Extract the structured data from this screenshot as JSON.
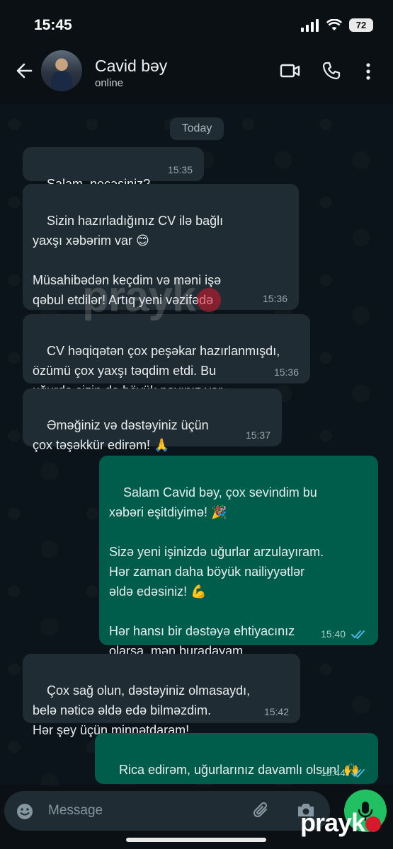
{
  "status_bar": {
    "time": "15:45",
    "battery": "72"
  },
  "header": {
    "contact_name": "Cavid bəy",
    "contact_status": "online"
  },
  "chat": {
    "date_chip": "Today",
    "messages": [
      {
        "text": "Salam, necəsiniz?",
        "time": "15:35"
      },
      {
        "text": "Sizin hazırladığınız CV ilə bağlı\nyaxşı xəbərim var 😊\n\nMüsahibədən keçdim və məni işə\nqəbul etdilər! Artıq yeni vəzifədə\nçalışıram.",
        "time": "15:36"
      },
      {
        "text": "CV həqiqətən çox peşəkar hazırlanmışdı,\nözümü çox yaxşı təqdim etdi. Bu\nuğurda sizin də böyük payınız var.",
        "time": "15:36"
      },
      {
        "text": "Əməğiniz və dəstəyiniz üçün\nçox təşəkkür edirəm! 🙏",
        "time": "15:37"
      },
      {
        "text": "Salam Cavid bəy, çox sevindim bu\nxəbəri eşitdiyimə! 🎉\n\nSizə yeni işinizdə uğurlar arzulayıram.\nHər zaman daha böyük nailiyyətlər\nəldə edəsiniz! 💪\n\nHər hansı bir dəstəyə ehtiyacınız\nolarsa, mən buradayam.",
        "time": "15:40"
      },
      {
        "text": "Çox sağ olun, dəstəyiniz olmasaydı,\nbelə nəticə əldə edə bilməzdim.\nHər şey üçün minnətdaram!",
        "time": "15:42"
      },
      {
        "text": "Rica edirəm, uğurlarınız davamlı olsun! 🙌",
        "time": "15:44"
      }
    ]
  },
  "composer": {
    "placeholder": "Message"
  },
  "watermark": {
    "text": "prayk"
  },
  "colors": {
    "incoming": "#202c33",
    "outgoing": "#005c4b",
    "accent": "#21c063",
    "read_ticks": "#53bdeb"
  },
  "icons": [
    "back-arrow-icon",
    "video-call-icon",
    "phone-icon",
    "more-vertical-icon",
    "emoji-icon",
    "attach-icon",
    "camera-icon",
    "mic-icon",
    "double-check-icon"
  ]
}
